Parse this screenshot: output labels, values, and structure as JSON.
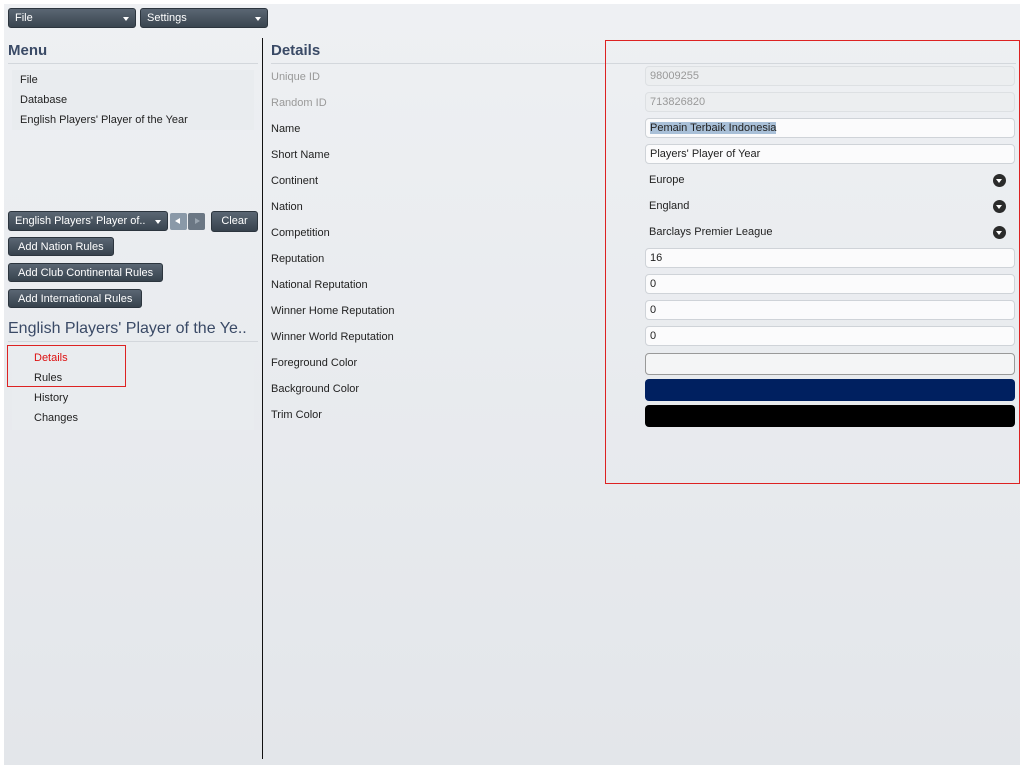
{
  "toolbar": {
    "file_label": "File",
    "settings_label": "Settings"
  },
  "menu": {
    "title": "Menu",
    "items": [
      {
        "label": "File"
      },
      {
        "label": "Database"
      },
      {
        "label": "English Players' Player of the Year"
      }
    ]
  },
  "selector": {
    "value": "English Players' Player of..",
    "clear_label": "Clear"
  },
  "actions": {
    "add_nation": "Add Nation Rules",
    "add_club_continental": "Add Club Continental Rules",
    "add_international": "Add International Rules"
  },
  "entity": {
    "title": "English Players' Player of the Ye..",
    "tabs": [
      {
        "label": "Details",
        "active": true
      },
      {
        "label": "Rules"
      },
      {
        "label": "History"
      },
      {
        "label": "Changes"
      }
    ]
  },
  "details": {
    "title": "Details",
    "unique_id": {
      "label": "Unique ID",
      "value": "98009255"
    },
    "random_id": {
      "label": "Random ID",
      "value": "713826820"
    },
    "name": {
      "label": "Name",
      "value": "Pemain Terbaik Indonesia"
    },
    "short_name": {
      "label": "Short Name",
      "value": "Players' Player of Year"
    },
    "continent": {
      "label": "Continent",
      "value": "Europe"
    },
    "nation": {
      "label": "Nation",
      "value": "England"
    },
    "competition": {
      "label": "Competition",
      "value": "Barclays Premier League"
    },
    "reputation": {
      "label": "Reputation",
      "value": "16"
    },
    "national_reputation": {
      "label": "National Reputation",
      "value": "0"
    },
    "winner_home_reputation": {
      "label": "Winner Home Reputation",
      "value": "0"
    },
    "winner_world_reputation": {
      "label": "Winner World Reputation",
      "value": "0"
    },
    "foreground_color": {
      "label": "Foreground Color",
      "value": "#f4f5f6"
    },
    "background_color": {
      "label": "Background Color",
      "value": "#002060"
    },
    "trim_color": {
      "label": "Trim Color",
      "value": "#000000"
    }
  }
}
